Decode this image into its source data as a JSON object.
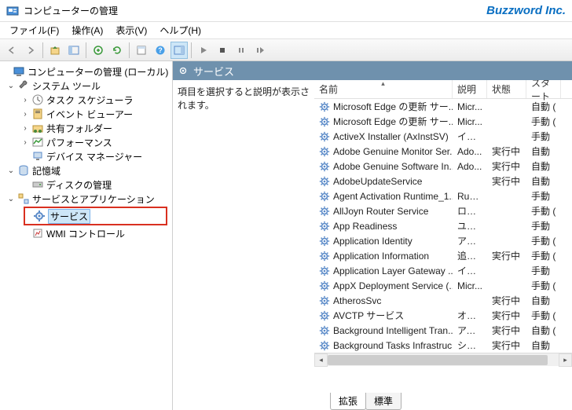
{
  "title": "コンピューターの管理",
  "brand": "Buzzword Inc.",
  "menu": [
    "ファイル(F)",
    "操作(A)",
    "表示(V)",
    "ヘルプ(H)"
  ],
  "tree": {
    "root": "コンピューターの管理 (ローカル)",
    "systools": "システム ツール",
    "systools_children": [
      "タスク スケジューラ",
      "イベント ビューアー",
      "共有フォルダー",
      "パフォーマンス",
      "デバイス マネージャー"
    ],
    "storage": "記憶域",
    "storage_children": [
      "ディスクの管理"
    ],
    "svcapps": "サービスとアプリケーション",
    "svcapps_children": [
      "サービス",
      "WMI コントロール"
    ]
  },
  "svc_header": "サービス",
  "desc_text": "項目を選択すると説明が表示されます。",
  "columns": {
    "name": "名前",
    "desc": "説明",
    "status": "状態",
    "startup": "スタート"
  },
  "services": [
    {
      "name": "Microsoft Edge の更新 サー...",
      "desc": "Micr...",
      "status": "",
      "startup": "自動 ("
    },
    {
      "name": "Microsoft Edge の更新 サー...",
      "desc": "Micr...",
      "status": "",
      "startup": "手動 ("
    },
    {
      "name": "ActiveX Installer (AxInstSV)",
      "desc": "インタ...",
      "status": "",
      "startup": "手動"
    },
    {
      "name": "Adobe Genuine Monitor Ser...",
      "desc": "Ado...",
      "status": "実行中",
      "startup": "自動"
    },
    {
      "name": "Adobe Genuine Software In...",
      "desc": "Ado...",
      "status": "実行中",
      "startup": "自動"
    },
    {
      "name": "AdobeUpdateService",
      "desc": "",
      "status": "実行中",
      "startup": "自動"
    },
    {
      "name": "Agent Activation Runtime_1...",
      "desc": "Runti...",
      "status": "",
      "startup": "手動"
    },
    {
      "name": "AllJoyn Router Service",
      "desc": "ローカ...",
      "status": "",
      "startup": "手動 ("
    },
    {
      "name": "App Readiness",
      "desc": "ユーザ...",
      "status": "",
      "startup": "手動"
    },
    {
      "name": "Application Identity",
      "desc": "アプリ...",
      "status": "",
      "startup": "手動 ("
    },
    {
      "name": "Application Information",
      "desc": "追加...",
      "status": "実行中",
      "startup": "手動 ("
    },
    {
      "name": "Application Layer Gateway ...",
      "desc": "インタ...",
      "status": "",
      "startup": "手動"
    },
    {
      "name": "AppX Deployment Service (...",
      "desc": "Micr...",
      "status": "",
      "startup": "手動 ("
    },
    {
      "name": "AtherosSvc",
      "desc": "",
      "status": "実行中",
      "startup": "自動"
    },
    {
      "name": "AVCTP サービス",
      "desc": "オーデ...",
      "status": "実行中",
      "startup": "手動 ("
    },
    {
      "name": "Background Intelligent Tran...",
      "desc": "アイド...",
      "status": "実行中",
      "startup": "自動 ("
    },
    {
      "name": "Background Tasks Infrastruc...",
      "desc": "システ...",
      "status": "実行中",
      "startup": "自動"
    }
  ],
  "tabs": {
    "ext": "拡張",
    "std": "標準"
  }
}
